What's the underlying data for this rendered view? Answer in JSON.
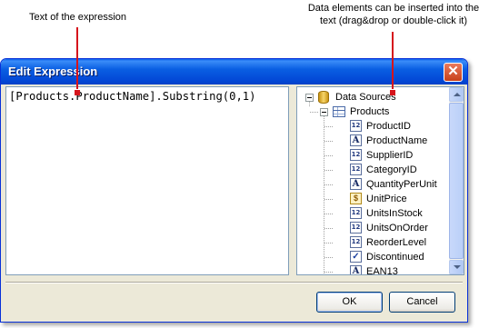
{
  "annotations": {
    "expression_text_label": "Text of the expression",
    "data_elements_label_line1": "Data elements can be inserted into the",
    "data_elements_label_line2": "text (drag&drop or double-click it)"
  },
  "dialog": {
    "title": "Edit Expression",
    "close_glyph": "✕",
    "expression": "[Products.ProductName].Substring(0,1)",
    "ok_label": "OK",
    "cancel_label": "Cancel"
  },
  "tree": {
    "root": {
      "label": "Data Sources",
      "icon": "database-icon",
      "expanded": true
    },
    "table": {
      "label": "Products",
      "icon": "table-icon",
      "expanded": true
    },
    "fields": [
      {
        "label": "ProductID",
        "type": "number",
        "icon_glyph": "12"
      },
      {
        "label": "ProductName",
        "type": "string",
        "icon_glyph": "A"
      },
      {
        "label": "SupplierID",
        "type": "number",
        "icon_glyph": "12"
      },
      {
        "label": "CategoryID",
        "type": "number",
        "icon_glyph": "12"
      },
      {
        "label": "QuantityPerUnit",
        "type": "string",
        "icon_glyph": "A"
      },
      {
        "label": "UnitPrice",
        "type": "currency",
        "icon_glyph": "$"
      },
      {
        "label": "UnitsInStock",
        "type": "number",
        "icon_glyph": "12"
      },
      {
        "label": "UnitsOnOrder",
        "type": "number",
        "icon_glyph": "12"
      },
      {
        "label": "ReorderLevel",
        "type": "number",
        "icon_glyph": "12"
      },
      {
        "label": "Discontinued",
        "type": "boolean",
        "icon_glyph": "✓"
      },
      {
        "label": "EAN13",
        "type": "string",
        "icon_glyph": "A"
      }
    ]
  },
  "colors": {
    "pointer": "#d6141c",
    "titlebar": "#0347d6",
    "dialog_face": "#ece9d8"
  }
}
